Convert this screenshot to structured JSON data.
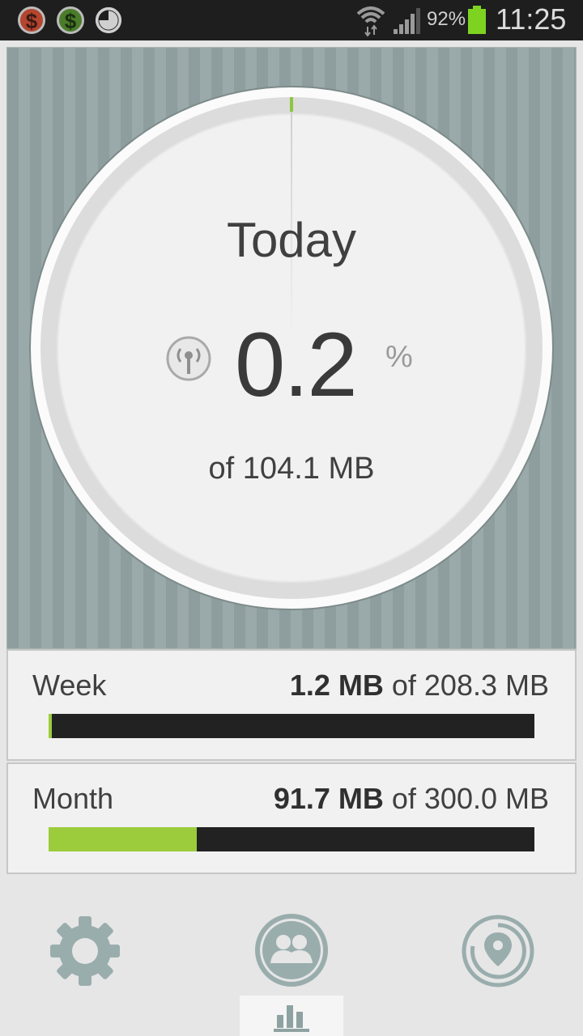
{
  "status_bar": {
    "notif_icons": [
      "dollar-red-icon",
      "dollar-green-icon",
      "clock-icon"
    ],
    "battery_percent": "92%",
    "time": "11:25",
    "colors": {
      "battery": "#7ed321"
    }
  },
  "gauge": {
    "title": "Today",
    "value": "0.2",
    "unit": "%",
    "total_text": "of 104.1 MB",
    "icon": "antenna-icon",
    "fill_fraction": 0.002,
    "colors": {
      "accent": "#8dc63f"
    }
  },
  "week": {
    "label": "Week",
    "used": "1.2 MB",
    "of_text": " of 208.3 MB",
    "fill_fraction": 0.006
  },
  "month": {
    "label": "Month",
    "used": "91.7 MB",
    "of_text": " of 300.0 MB",
    "fill_fraction": 0.3057
  },
  "nav": {
    "items": [
      "settings-icon",
      "people-icon",
      "location-icon"
    ],
    "active_tab": "stats-icon"
  }
}
